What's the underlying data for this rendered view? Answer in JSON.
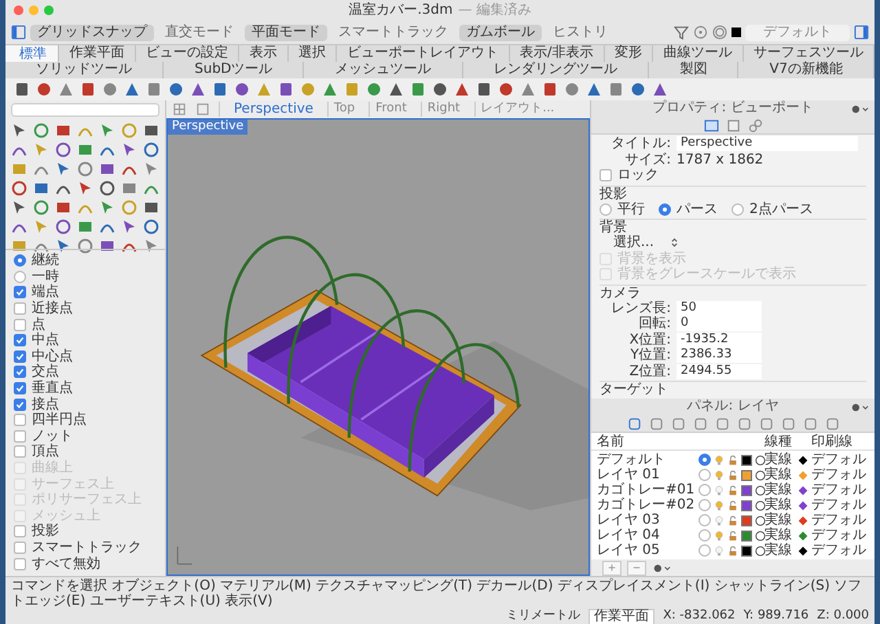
{
  "window": {
    "title": "温室カバー.3dm",
    "subtitle": "— 編集済み"
  },
  "modes": [
    {
      "label": "グリッドスナップ",
      "on": true
    },
    {
      "label": "直交モード",
      "on": false
    },
    {
      "label": "平面モード",
      "on": true
    },
    {
      "label": "スマートトラック",
      "on": false
    },
    {
      "label": "ガムボール",
      "on": true
    },
    {
      "label": "ヒストリ",
      "on": false
    }
  ],
  "layer_select": {
    "value": "デフォルト"
  },
  "tabs": [
    {
      "label": "標準",
      "selected": true
    },
    {
      "label": "作業平面",
      "selected": false
    },
    {
      "label": "ビューの設定",
      "selected": false
    },
    {
      "label": "表示",
      "selected": false
    },
    {
      "label": "選択",
      "selected": false
    },
    {
      "label": "ビューポートレイアウト",
      "selected": false
    },
    {
      "label": "表示/非表示",
      "selected": false
    },
    {
      "label": "変形",
      "selected": false
    },
    {
      "label": "曲線ツール",
      "selected": false
    },
    {
      "label": "サーフェスツール",
      "selected": false
    },
    {
      "label": "ソリッドツール",
      "selected": false
    },
    {
      "label": "SubDツール",
      "selected": false
    },
    {
      "label": "メッシュツール",
      "selected": false
    },
    {
      "label": "レンダリングツール",
      "selected": false
    },
    {
      "label": "製図",
      "selected": false
    },
    {
      "label": "V7の新機能",
      "selected": false
    }
  ],
  "viewport": {
    "label": "Perspective",
    "tabs": [
      {
        "label": "Perspective",
        "selected": true
      },
      {
        "label": "Top",
        "selected": false
      },
      {
        "label": "Front",
        "selected": false
      },
      {
        "label": "Right",
        "selected": false
      },
      {
        "label": "レイアウト...",
        "selected": false
      }
    ]
  },
  "osnaps": [
    {
      "kind": "radio",
      "label": "継続",
      "checked": true,
      "disabled": false
    },
    {
      "kind": "radio",
      "label": "一時",
      "checked": false,
      "disabled": false
    },
    {
      "kind": "check",
      "label": "端点",
      "checked": true,
      "disabled": false
    },
    {
      "kind": "check",
      "label": "近接点",
      "checked": false,
      "disabled": false
    },
    {
      "kind": "check",
      "label": "点",
      "checked": false,
      "disabled": false
    },
    {
      "kind": "check",
      "label": "中点",
      "checked": true,
      "disabled": false
    },
    {
      "kind": "check",
      "label": "中心点",
      "checked": true,
      "disabled": false
    },
    {
      "kind": "check",
      "label": "交点",
      "checked": true,
      "disabled": false
    },
    {
      "kind": "check",
      "label": "垂直点",
      "checked": true,
      "disabled": false
    },
    {
      "kind": "check",
      "label": "接点",
      "checked": true,
      "disabled": false
    },
    {
      "kind": "check",
      "label": "四半円点",
      "checked": false,
      "disabled": false
    },
    {
      "kind": "check",
      "label": "ノット",
      "checked": false,
      "disabled": false
    },
    {
      "kind": "check",
      "label": "頂点",
      "checked": false,
      "disabled": false
    },
    {
      "kind": "check",
      "label": "曲線上",
      "checked": false,
      "disabled": true
    },
    {
      "kind": "check",
      "label": "サーフェス上",
      "checked": false,
      "disabled": true
    },
    {
      "kind": "check",
      "label": "ポリサーフェス上",
      "checked": false,
      "disabled": true
    },
    {
      "kind": "check",
      "label": "メッシュ上",
      "checked": false,
      "disabled": true
    },
    {
      "kind": "check",
      "label": "投影",
      "checked": false,
      "disabled": false
    },
    {
      "kind": "check",
      "label": "スマートトラック",
      "checked": false,
      "disabled": false
    },
    {
      "kind": "check",
      "label": "すべて無効",
      "checked": false,
      "disabled": false
    }
  ],
  "properties": {
    "title": "プロパティ: ビューポート",
    "title_field": {
      "label": "タイトル:",
      "value": "Perspective"
    },
    "size": {
      "label": "サイズ:",
      "value": "1787 x 1862"
    },
    "lock": {
      "label": "ロック",
      "checked": false
    },
    "projection": {
      "heading": "投影",
      "options": [
        {
          "label": "平行",
          "selected": false
        },
        {
          "label": "パース",
          "selected": true
        },
        {
          "label": "2点パース",
          "selected": false
        }
      ]
    },
    "background": {
      "heading": "背景",
      "select": "選択...",
      "options": [
        {
          "label": "背景を表示",
          "checked": false,
          "disabled": true
        },
        {
          "label": "背景をグレースケールで表示",
          "checked": false,
          "disabled": true
        }
      ]
    },
    "camera": {
      "heading": "カメラ",
      "fields": [
        {
          "label": "レンズ長:",
          "value": "50"
        },
        {
          "label": "回転:",
          "value": "0"
        },
        {
          "label": "X位置:",
          "value": "-1935.2"
        },
        {
          "label": "Y位置:",
          "value": "2386.33"
        },
        {
          "label": "Z位置:",
          "value": "2494.55"
        }
      ]
    },
    "target": {
      "heading": "ターゲット"
    }
  },
  "layers": {
    "title": "パネル: レイヤ",
    "columns": [
      "名前",
      "線種",
      "印刷線"
    ],
    "rows": [
      {
        "name": "デフォルト",
        "current": true,
        "visible": true,
        "color": "#000000",
        "linetype": "実線",
        "print_width": "デフォル"
      },
      {
        "name": "レイヤ 01",
        "current": false,
        "visible": true,
        "color": "#f0a030",
        "linetype": "実線",
        "print_width": "デフォル"
      },
      {
        "name": "カゴトレー#01",
        "current": false,
        "visible": false,
        "color": "#8040d0",
        "linetype": "実線",
        "print_width": "デフォル"
      },
      {
        "name": "カゴトレー#02",
        "current": false,
        "visible": true,
        "color": "#8040d0",
        "linetype": "実線",
        "print_width": "デフォル"
      },
      {
        "name": "レイヤ 03",
        "current": false,
        "visible": false,
        "color": "#e03a20",
        "linetype": "実線",
        "print_width": "デフォル"
      },
      {
        "name": "レイヤ 04",
        "current": false,
        "visible": true,
        "color": "#2f8a2f",
        "linetype": "実線",
        "print_width": "デフォル"
      },
      {
        "name": "レイヤ 05",
        "current": false,
        "visible": false,
        "color": "#000000",
        "linetype": "実線",
        "print_width": "デフォル"
      }
    ]
  },
  "status_bar": {
    "text": "コマンドを選択 オブジェクト(O) マテリアル(M) テクスチャマッピング(T) デカール(D) ディスプレイスメント(I) シャットライン(S) ソフトエッジ(E) ユーザーテキスト(U) 表示(V)",
    "units": "ミリメートル",
    "cplane": "作業平面",
    "x": "X: -832.062",
    "y": "Y: 989.716",
    "z": "Z: 0.000"
  }
}
